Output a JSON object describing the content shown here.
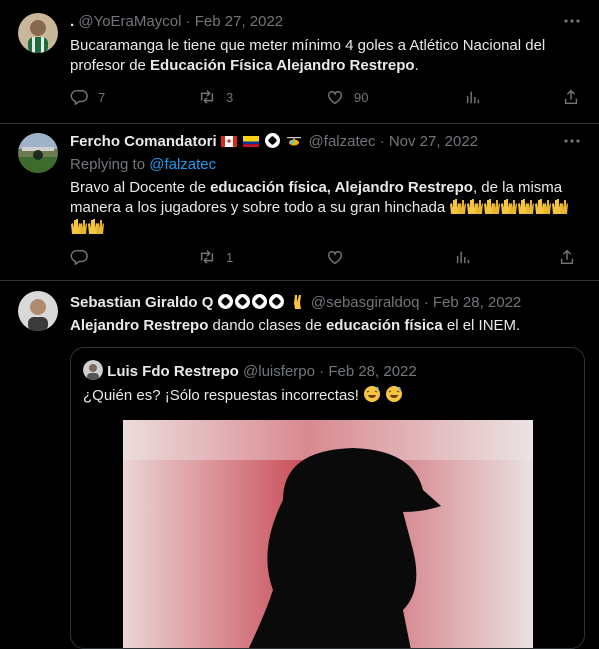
{
  "tweets": [
    {
      "display_name": ".",
      "handle": "@YoEraMaycol",
      "sep": "·",
      "date": "Feb 27, 2022",
      "text_parts": [
        "Bucaramanga le tiene que meter mínimo 4 goles a Atlético Nacional del profesor de ",
        "Educación Física Alejandro Restrepo",
        "."
      ],
      "replies": "7",
      "retweets": "3",
      "likes": "90"
    },
    {
      "display_name": "Fercho Comandatori",
      "handle": "@falzatec",
      "sep": "·",
      "date": "Nov 27, 2022",
      "replying_to_label": "Replying to",
      "replying_to_handle": "@falzatec",
      "text_parts": [
        "Bravo al Docente de ",
        "educación física, Alejandro Restrepo",
        ", de la misma manera a los jugadores y sobre todo a su gran hinchada "
      ],
      "replies": "",
      "retweets": "1",
      "likes": ""
    },
    {
      "display_name": "Sebastian Giraldo Q",
      "handle": "@sebasgiraldoq",
      "sep": "·",
      "date": "Feb 28, 2022",
      "text_parts": [
        "Alejandro Restrepo",
        " dando clases de ",
        "educación física",
        " el el INEM."
      ]
    }
  ],
  "quoted": {
    "display_name": "Luis Fdo Restrepo",
    "handle": "@luisferpo",
    "sep": "·",
    "date": "Feb 28, 2022",
    "text": "¿Quién es? ¡Sólo respuestas incorrectas!"
  },
  "icons": {
    "reply": "reply-icon",
    "retweet": "retweet-icon",
    "like": "heart-icon",
    "views": "views-icon",
    "share": "share-icon",
    "more": "more-icon"
  },
  "colors": {
    "link": "#1d9bf0",
    "muted": "#71767b",
    "text": "#e7e9ea",
    "background": "#000000"
  }
}
